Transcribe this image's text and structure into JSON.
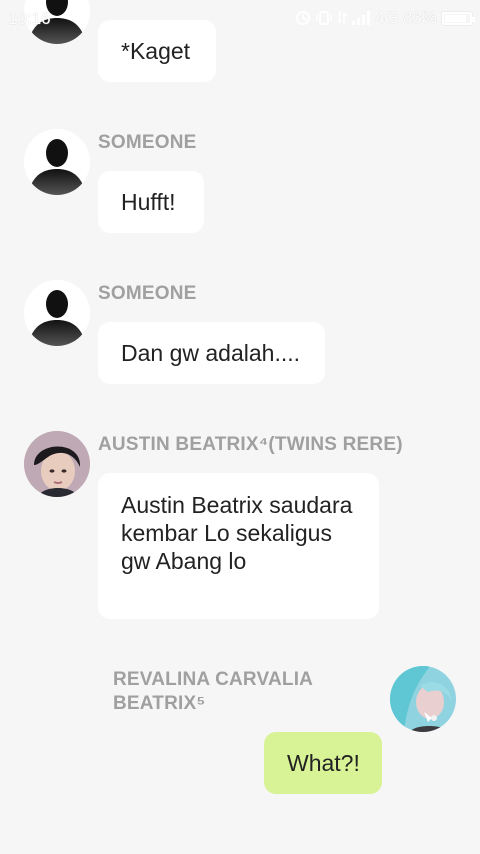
{
  "status_bar": {
    "time": "10:16",
    "network": "4G",
    "battery": "83%",
    "battery_level": 0.83
  },
  "colors": {
    "background": "#f6f6f6",
    "bubble_other": "#ffffff",
    "bubble_me": "#d8f396",
    "name_text": "#a0a0a0",
    "message_text": "#222222"
  },
  "messages": [
    {
      "sender": "",
      "text": "*Kaget",
      "avatar": "silhouette-avatar"
    },
    {
      "sender": "SOMEONE",
      "text": "Hufft!",
      "avatar": "silhouette-avatar"
    },
    {
      "sender": "SOMEONE",
      "text": "Dan gw adalah....",
      "avatar": "silhouette-avatar"
    },
    {
      "sender": "AUSTIN BEATRIX⁴(TWINS RERE)",
      "text": "Austin Beatrix saudara kembar Lo sekaligus gw Abang lo",
      "avatar": "photo-avatar-dark-hair"
    },
    {
      "sender": "REVALINA CARVALIA BEATRIX⁵",
      "text": "What?!",
      "avatar": "photo-avatar-blue-hair"
    }
  ]
}
